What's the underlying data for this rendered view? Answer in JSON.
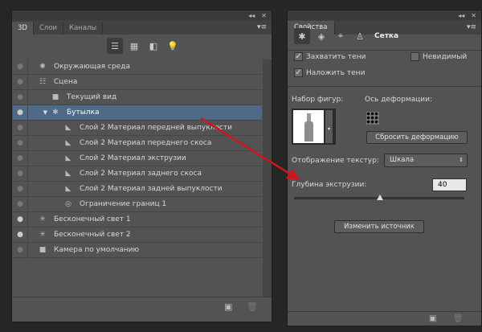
{
  "left_panel": {
    "tabs": [
      "3D",
      "Слои",
      "Каналы"
    ],
    "toolbar_icons": [
      "scene-filter-icon",
      "mesh-filter-icon",
      "material-filter-icon",
      "light-filter-icon"
    ],
    "layers": [
      {
        "label": "Окружающая среда",
        "icon": "environment-icon",
        "indent": 0
      },
      {
        "label": "Сцена",
        "icon": "scene-icon",
        "indent": 0
      },
      {
        "label": "Текущий вид",
        "icon": "camera-icon",
        "indent": 1
      },
      {
        "label": "Бутылка",
        "icon": "mesh-icon",
        "indent": 1,
        "selected": true,
        "expanded": true
      },
      {
        "label": "Слой 2 Материал передней выпуклости",
        "icon": "material-icon",
        "indent": 2
      },
      {
        "label": "Слой 2 Материал переднего скоса",
        "icon": "material-icon",
        "indent": 2
      },
      {
        "label": "Слой 2 Материал экструзии",
        "icon": "material-icon",
        "indent": 2
      },
      {
        "label": "Слой 2 Материал заднего скоса",
        "icon": "material-icon",
        "indent": 2
      },
      {
        "label": "Слой 2 Материал задней выпуклости",
        "icon": "material-icon",
        "indent": 2
      },
      {
        "label": "Ограничение границ 1",
        "icon": "boundary-icon",
        "indent": 2
      },
      {
        "label": "Бесконечный свет 1",
        "icon": "light-icon",
        "indent": 0
      },
      {
        "label": "Бесконечный свет 2",
        "icon": "light-icon",
        "indent": 0
      },
      {
        "label": "Камера по умолчанию",
        "icon": "camera-icon",
        "indent": 0
      }
    ]
  },
  "properties": {
    "tab": "Свойства",
    "section_title": "Сетка",
    "catch_shadows": "Захватить тени",
    "invisible": "Невидимый",
    "cast_shadows": "Наложить тени",
    "shape_preset": "Набор фигур:",
    "deform_axis": "Ось деформации:",
    "reset_button": "Сбросить деформацию",
    "texture_label": "Отображение текстур:",
    "texture_value": "Шкала",
    "depth_label": "Глубина экструзии:",
    "depth_value": "40",
    "edit_source_button": "Изменить источник"
  },
  "colors": {
    "selection": "#4f6a87",
    "arrow": "#d0161b"
  }
}
